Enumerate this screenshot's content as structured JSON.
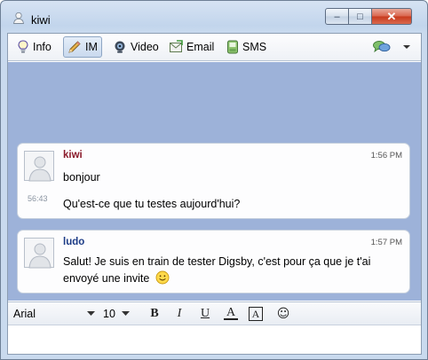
{
  "window": {
    "title": "kiwi",
    "controls": {
      "minimize": "–",
      "maximize": "□",
      "close": "✕"
    }
  },
  "toolbar": {
    "items": [
      {
        "label": "Info",
        "icon": "bulb-icon"
      },
      {
        "label": "IM",
        "icon": "pencil-icon",
        "active": true
      },
      {
        "label": "Video",
        "icon": "webcam-icon"
      },
      {
        "label": "Email",
        "icon": "email-icon"
      },
      {
        "label": "SMS",
        "icon": "phone-icon"
      }
    ],
    "more_icon": "chat-bubbles-icon"
  },
  "messages": [
    {
      "sender": "kiwi",
      "time": "1:56 PM",
      "lines": [
        "bonjour",
        "Qu'est-ce que tu testes aujourd'hui?"
      ],
      "sub_time": "56:43",
      "name_color": "#8a1a2a"
    },
    {
      "sender": "ludo",
      "time": "1:57 PM",
      "lines": [
        "Salut! Je suis en train de tester Digsby, c'est pour ça que je t'ai",
        "envoyé une invite"
      ],
      "emoticon": "smiley-icon",
      "name_color": "#1d3c86"
    }
  ],
  "format_bar": {
    "font": "Arial",
    "size": "10",
    "bold": "B",
    "italic": "I",
    "underline": "U",
    "font_color": "A",
    "background_color": "A",
    "emoticon": "☺"
  },
  "colors": {
    "chat_background": "#9db2d9",
    "accent": "#8ea6c4"
  }
}
